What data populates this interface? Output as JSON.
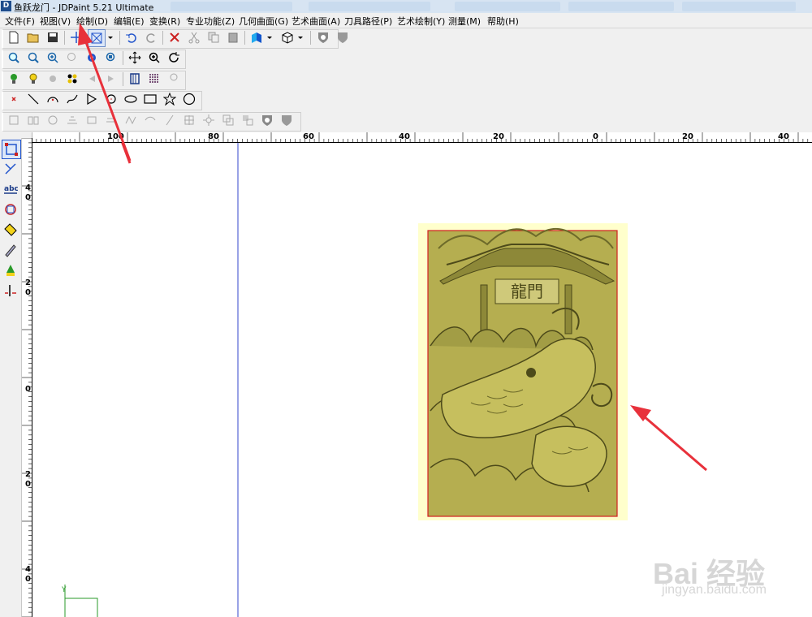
{
  "window": {
    "title": "鱼跃龙门 - JDPaint 5.21 Ultimate",
    "icon": "jdpaint-app-icon"
  },
  "menu": [
    {
      "label": "文件(F)"
    },
    {
      "label": "视图(V)"
    },
    {
      "label": "绘制(D)"
    },
    {
      "label": "编辑(E)"
    },
    {
      "label": "变换(R)"
    },
    {
      "label": "专业功能(Z)"
    },
    {
      "label": "几何曲面(G)"
    },
    {
      "label": "艺术曲面(A)"
    },
    {
      "label": "刀具路径(P)"
    },
    {
      "label": "艺术绘制(Y)"
    },
    {
      "label": "测量(M)"
    },
    {
      "label": "帮助(H)"
    }
  ],
  "ruler": {
    "horizontal": [
      "100",
      "80",
      "60",
      "40",
      "20",
      "0",
      "20",
      "40"
    ],
    "vertical": [
      "4",
      "0",
      "2",
      "0",
      "0",
      "2",
      "0",
      "4",
      "0"
    ]
  },
  "canvas": {
    "plaque_text": "龍門",
    "background": "#ffffff",
    "selection_bg": "#ffffcc",
    "relief_color": "#b5ae50",
    "border_color": "#d11f1f",
    "axis_color": "#3344cc"
  },
  "watermark": {
    "logo": "Bai 经验",
    "url": "jingyan.baidu.com"
  },
  "annotations": {
    "arrow_color": "#e8313b"
  }
}
